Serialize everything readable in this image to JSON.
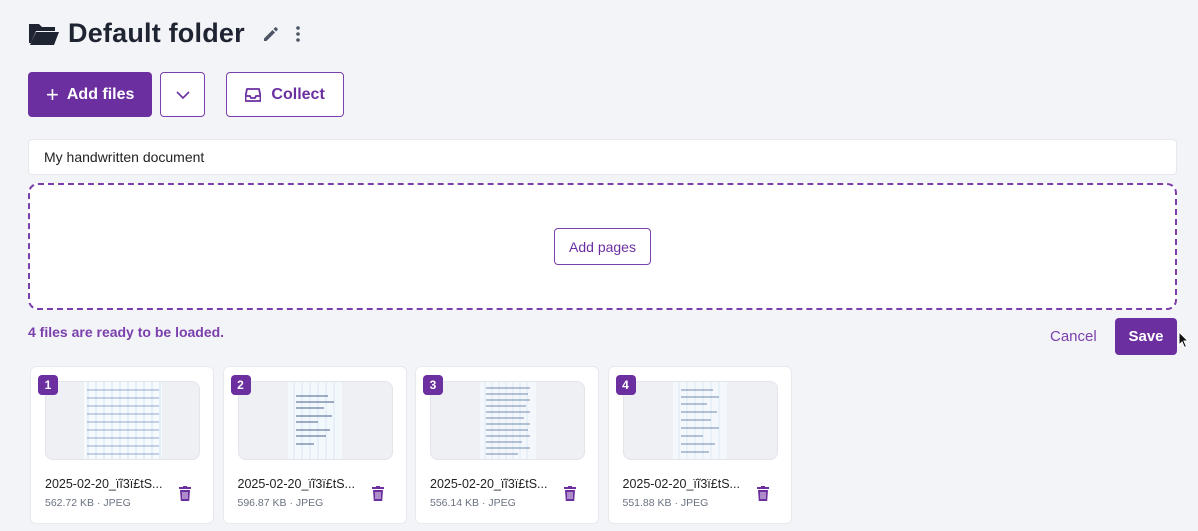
{
  "header": {
    "title": "Default folder",
    "icons": {
      "folder": "folder-open-icon",
      "edit": "pencil-icon",
      "more": "kebab-menu-icon"
    }
  },
  "toolbar": {
    "add_files_label": "Add files",
    "dropdown_icon": "chevron-down-icon",
    "collect_label": "Collect",
    "collect_icon": "inbox-tray-icon"
  },
  "document": {
    "name_value": "My handwritten document"
  },
  "dropzone": {
    "add_pages_label": "Add pages"
  },
  "status": {
    "ready_text": "4 files are ready to be loaded.",
    "cancel_label": "Cancel",
    "save_label": "Save"
  },
  "files": [
    {
      "index": "1",
      "name": "2025-02-20_ïĩ3ï£tS...",
      "meta": "562.72 KB · JPEG"
    },
    {
      "index": "2",
      "name": "2025-02-20_ïĩ3ï£tS...",
      "meta": "596.87 KB · JPEG"
    },
    {
      "index": "3",
      "name": "2025-02-20_ïĩ3ï£tS...",
      "meta": "556.14 KB · JPEG"
    },
    {
      "index": "4",
      "name": "2025-02-20_ïĩ3ï£tS...",
      "meta": "551.88 KB · JPEG"
    }
  ],
  "colors": {
    "accent": "#6b2fa0",
    "background": "#f3f4f7",
    "title": "#1f2433"
  }
}
